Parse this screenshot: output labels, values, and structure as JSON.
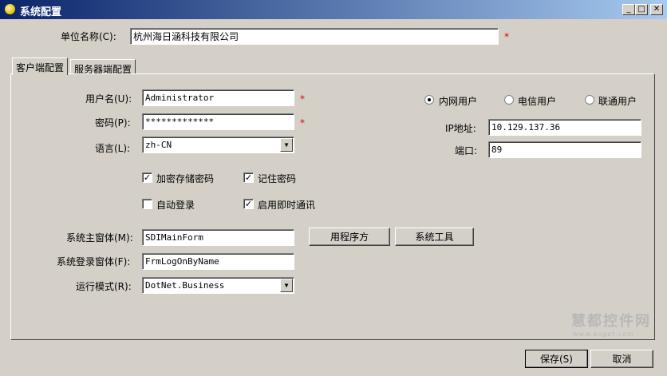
{
  "window": {
    "title": "系统配置",
    "min_glyph": "_",
    "max_glyph": "□",
    "close_glyph": "✕"
  },
  "company": {
    "label": "单位名称(C):",
    "value": "杭州海日涵科技有限公司",
    "required_mark": "*"
  },
  "tabs": [
    {
      "label": "客户端配置",
      "active": true
    },
    {
      "label": "服务器端配置",
      "active": false
    }
  ],
  "client": {
    "username": {
      "label": "用户名(U):",
      "value": "Administrator",
      "required_mark": "*"
    },
    "password": {
      "label": "密码(P):",
      "value": "*************",
      "required_mark": "*"
    },
    "language": {
      "label": "语言(L):",
      "value": "zh-CN"
    },
    "checkboxes": {
      "encrypt_password": {
        "label": "加密存储密码",
        "checked": true
      },
      "remember_password": {
        "label": "记住密码",
        "checked": true
      },
      "auto_login": {
        "label": "自动登录",
        "checked": false
      },
      "instant_messaging": {
        "label": "启用即时通讯",
        "checked": true
      }
    },
    "main_form": {
      "label": "系统主窗体(M):",
      "value": "SDIMainForm"
    },
    "login_form": {
      "label": "系统登录窗体(F):",
      "value": "FrmLogOnByName"
    },
    "run_mode": {
      "label": "运行模式(R):",
      "value": "DotNet.Business"
    },
    "buttons": {
      "app_prescription": "用程序方",
      "system_tools": "系统工具"
    },
    "user_type": {
      "options": [
        "内网用户",
        "电信用户",
        "联通用户"
      ],
      "selected": "内网用户"
    },
    "ip": {
      "label": "IP地址:",
      "value": "10.129.137.36"
    },
    "port": {
      "label": "端口:",
      "value": "89"
    }
  },
  "footer": {
    "save": "保存(S)",
    "cancel": "取消"
  },
  "watermark": {
    "main": "慧都控件网",
    "sub": "www.evget.com"
  },
  "colors": {
    "title_gradient_start": "#0a246a",
    "title_gradient_end": "#a6caf0",
    "dialog_face": "#d4d0c8",
    "required": "#e00000"
  }
}
